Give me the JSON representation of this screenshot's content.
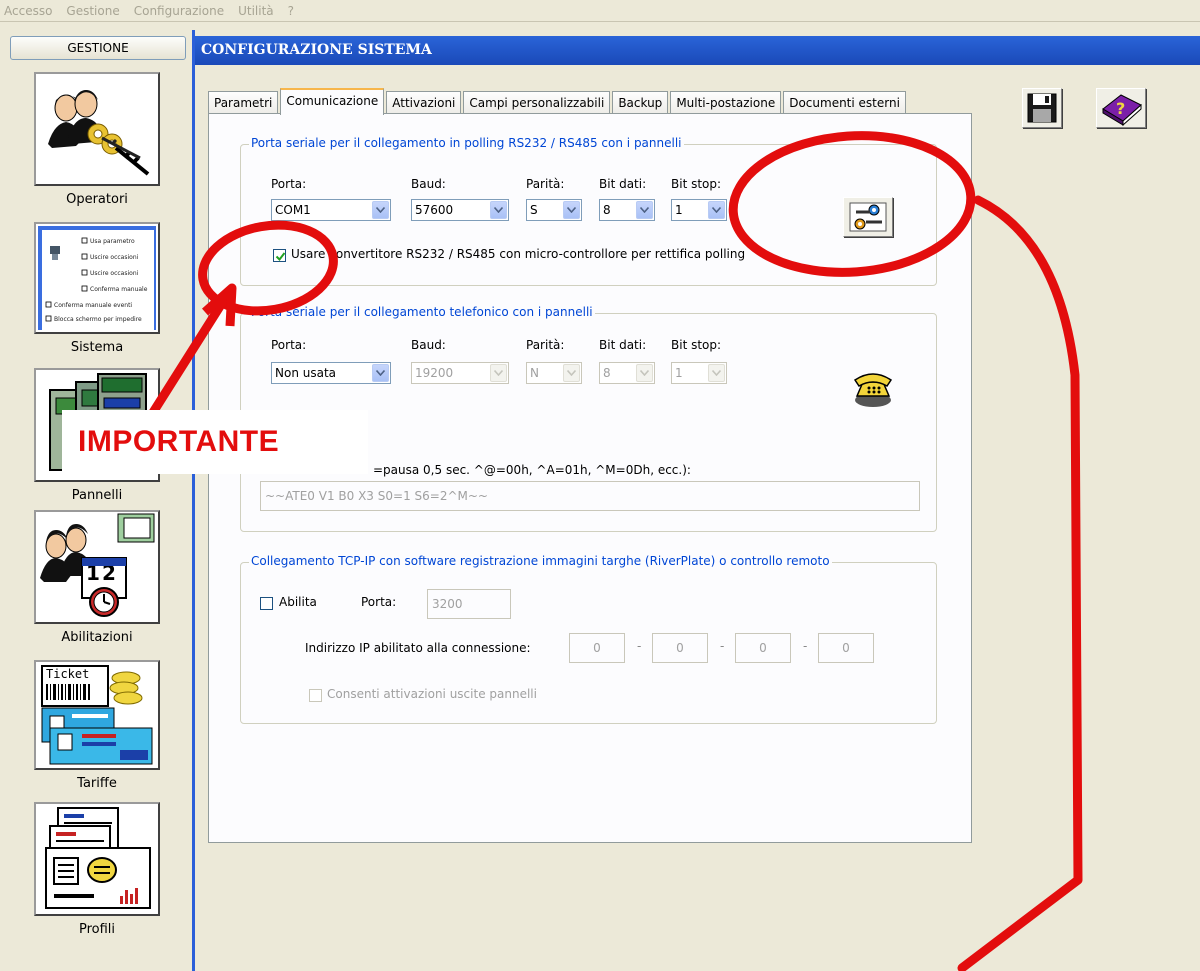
{
  "menu": [
    "Accesso",
    "Gestione",
    "Configurazione",
    "Utilità",
    "?"
  ],
  "sidebar": {
    "header": "GESTIONE",
    "items": [
      {
        "label": "Operatori",
        "icon": "operators-keys-icon"
      },
      {
        "label": "Sistema",
        "icon": "system-settings-icon"
      },
      {
        "label": "Pannelli",
        "icon": "panels-devices-icon"
      },
      {
        "label": "Abilitazioni",
        "icon": "calendar-clock-icon"
      },
      {
        "label": "Tariffe",
        "icon": "ticket-coins-icon"
      },
      {
        "label": "Profili",
        "icon": "profiles-documents-icon"
      }
    ]
  },
  "header": {
    "title": "CONFIGURAZIONE SISTEMA"
  },
  "tabs": [
    {
      "label": "Parametri",
      "active": false
    },
    {
      "label": "Comunicazione",
      "active": true
    },
    {
      "label": "Attivazioni",
      "active": false
    },
    {
      "label": "Campi personalizzabili",
      "active": false
    },
    {
      "label": "Backup",
      "active": false
    },
    {
      "label": "Multi-postazione",
      "active": false
    },
    {
      "label": "Documenti esterni",
      "active": false
    }
  ],
  "polling": {
    "legend": "Porta seriale per il collegamento in polling RS232 / RS485 con i pannelli",
    "labels": {
      "porta": "Porta:",
      "baud": "Baud:",
      "parita": "Parità:",
      "bitdati": "Bit dati:",
      "bitstop": "Bit stop:"
    },
    "values": {
      "porta": "COM1",
      "baud": "57600",
      "parita": "S",
      "bitdati": "8",
      "bitstop": "1"
    },
    "converter_checked": true,
    "converter_label": "Usare convertitore RS232 / RS485 con micro-controllore per rettifica polling"
  },
  "phone": {
    "legend": "Porta seriale per il collegamento telefonico con i pannelli",
    "labels": {
      "porta": "Porta:",
      "baud": "Baud:",
      "parita": "Parità:",
      "bitdati": "Bit dati:",
      "bitstop": "Bit stop:"
    },
    "values": {
      "porta": "Non usata",
      "baud": "19200",
      "parita": "N",
      "bitdati": "8",
      "bitstop": "1"
    },
    "init_label_partial": "=pausa 0,5 sec. ^@=00h, ^A=01h, ^M=0Dh, ecc.):",
    "init_value": "~~ATE0 V1 B0 X3 S0=1 S6=2^M~~"
  },
  "tcp": {
    "legend": "Collegamento TCP-IP con software registrazione immagini targhe (RiverPlate) o controllo remoto",
    "enable_label": "Abilita",
    "enable_checked": false,
    "port_label": "Porta:",
    "port_value": "3200",
    "ip_label": "Indirizzo IP abilitato alla connessione:",
    "ip": [
      "0",
      "0",
      "0",
      "0"
    ],
    "ip_sep": "-",
    "allow_label": "Consenti attivazioni uscite pannelli",
    "allow_checked": false
  },
  "toolbar": {
    "save_icon": "floppy-disk-icon",
    "help_icon": "help-book-icon"
  },
  "annotation": {
    "text": "IMPORTANTE",
    "color": "#e30d0d"
  }
}
